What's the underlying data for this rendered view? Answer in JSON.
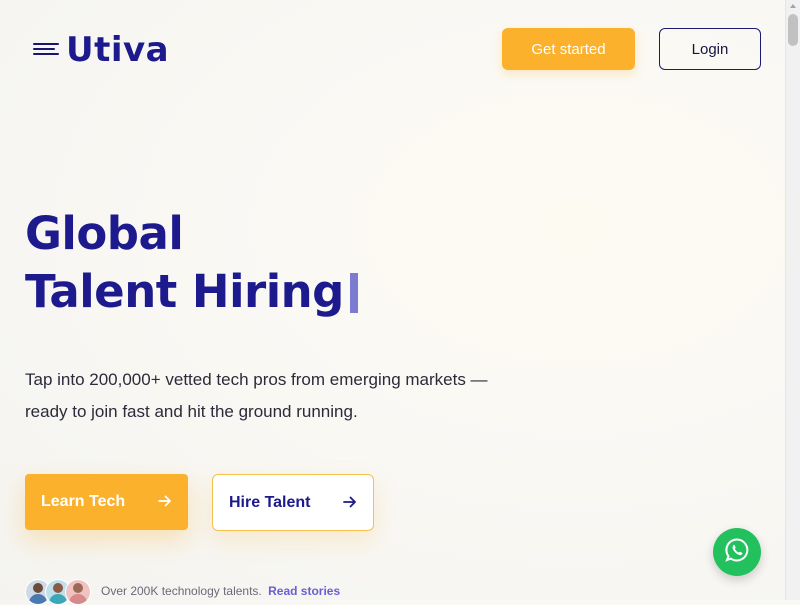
{
  "header": {
    "logo_text": "Utiva",
    "get_started_label": "Get started",
    "login_label": "Login"
  },
  "hero": {
    "title_line1": "Global",
    "title_line2": "Talent Hiring",
    "subtitle": "Tap into 200,000+ vetted tech pros from emerging markets — ready to join fast and hit the ground running.",
    "learn_tech_label": "Learn Tech",
    "hire_talent_label": "Hire Talent"
  },
  "social_proof": {
    "text": "Over 200K technology talents.",
    "link_label": "Read stories"
  },
  "icons": {
    "menu": "hamburger-menu-icon",
    "arrow": "arrow-right-icon",
    "whatsapp": "whatsapp-icon"
  },
  "colors": {
    "brand": "#1c1a8c",
    "accent": "#fbb12b",
    "whatsapp": "#22c15e",
    "link": "#6a5fd0"
  }
}
